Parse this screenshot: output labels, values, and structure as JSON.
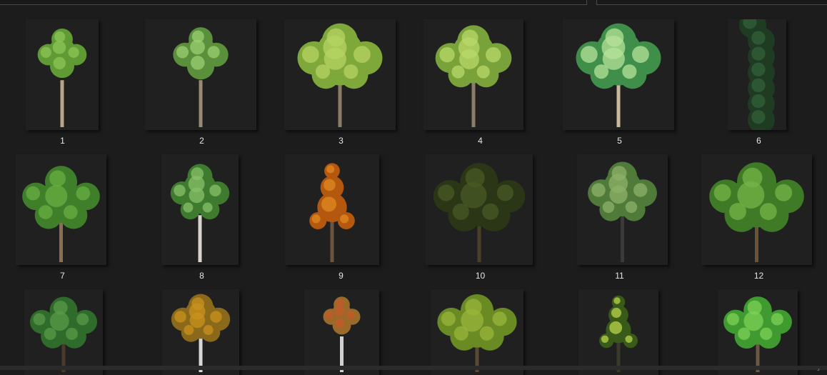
{
  "items": [
    {
      "label": "1",
      "leaf": "#5f9a35",
      "leaf2": "#8cc456",
      "trunk": "#b8a48a",
      "shape": "tall"
    },
    {
      "label": "2",
      "leaf": "#5a8f3c",
      "leaf2": "#9bcf72",
      "trunk": "#9a8a74",
      "shape": "slim"
    },
    {
      "label": "3",
      "leaf": "#7fa83b",
      "leaf2": "#b6d461",
      "trunk": "#8a7c68",
      "shape": "round"
    },
    {
      "label": "4",
      "leaf": "#7aa23a",
      "leaf2": "#b9d86a",
      "trunk": "#8a7c68",
      "shape": "round"
    },
    {
      "label": "5",
      "leaf": "#3f8f4a",
      "leaf2": "#b7e29a",
      "trunk": "#c8b89c",
      "shape": "round"
    },
    {
      "label": "6",
      "leaf": "#1f3b22",
      "leaf2": "#33603a",
      "trunk": "#2b2b2b",
      "shape": "column"
    },
    {
      "label": "7",
      "leaf": "#3f7f2a",
      "leaf2": "#69ad42",
      "trunk": "#8a6f52",
      "shape": "dome"
    },
    {
      "label": "8",
      "leaf": "#3e7b2f",
      "leaf2": "#88c06a",
      "trunk": "#d8d4cc",
      "shape": "oval"
    },
    {
      "label": "9",
      "leaf": "#b4580f",
      "leaf2": "#e08a22",
      "trunk": "#6b5440",
      "shape": "conic"
    },
    {
      "label": "10",
      "leaf": "#2a3616",
      "leaf2": "#4a5a24",
      "trunk": "#4a3f2a",
      "shape": "wide"
    },
    {
      "label": "11",
      "leaf": "#4f7a3a",
      "leaf2": "#8cb16a",
      "trunk": "#3a3a3a",
      "shape": "oval"
    },
    {
      "label": "12",
      "leaf": "#3f7a26",
      "leaf2": "#76b448",
      "trunk": "#6a5438",
      "shape": "wide"
    },
    {
      "label": "",
      "leaf": "#2f6b2a",
      "leaf2": "#5a9a4a",
      "trunk": "#4a3a2a",
      "shape": "dome"
    },
    {
      "label": "",
      "leaf": "#8a6a1a",
      "leaf2": "#c8921e",
      "trunk": "#d8d8d8",
      "shape": "oval"
    },
    {
      "label": "",
      "leaf": "#9a6a2a",
      "leaf2": "#c45a2a",
      "trunk": "#d0d0d0",
      "shape": "slim"
    },
    {
      "label": "",
      "leaf": "#6a8a24",
      "leaf2": "#9ab63a",
      "trunk": "#5a4a34",
      "shape": "dome"
    },
    {
      "label": "",
      "leaf": "#3a5a1a",
      "leaf2": "#b8d44a",
      "trunk": "#3a3a2a",
      "shape": "conic"
    },
    {
      "label": "",
      "leaf": "#3f9a2f",
      "leaf2": "#7ed055",
      "trunk": "#6a5a44",
      "shape": "dome"
    }
  ]
}
